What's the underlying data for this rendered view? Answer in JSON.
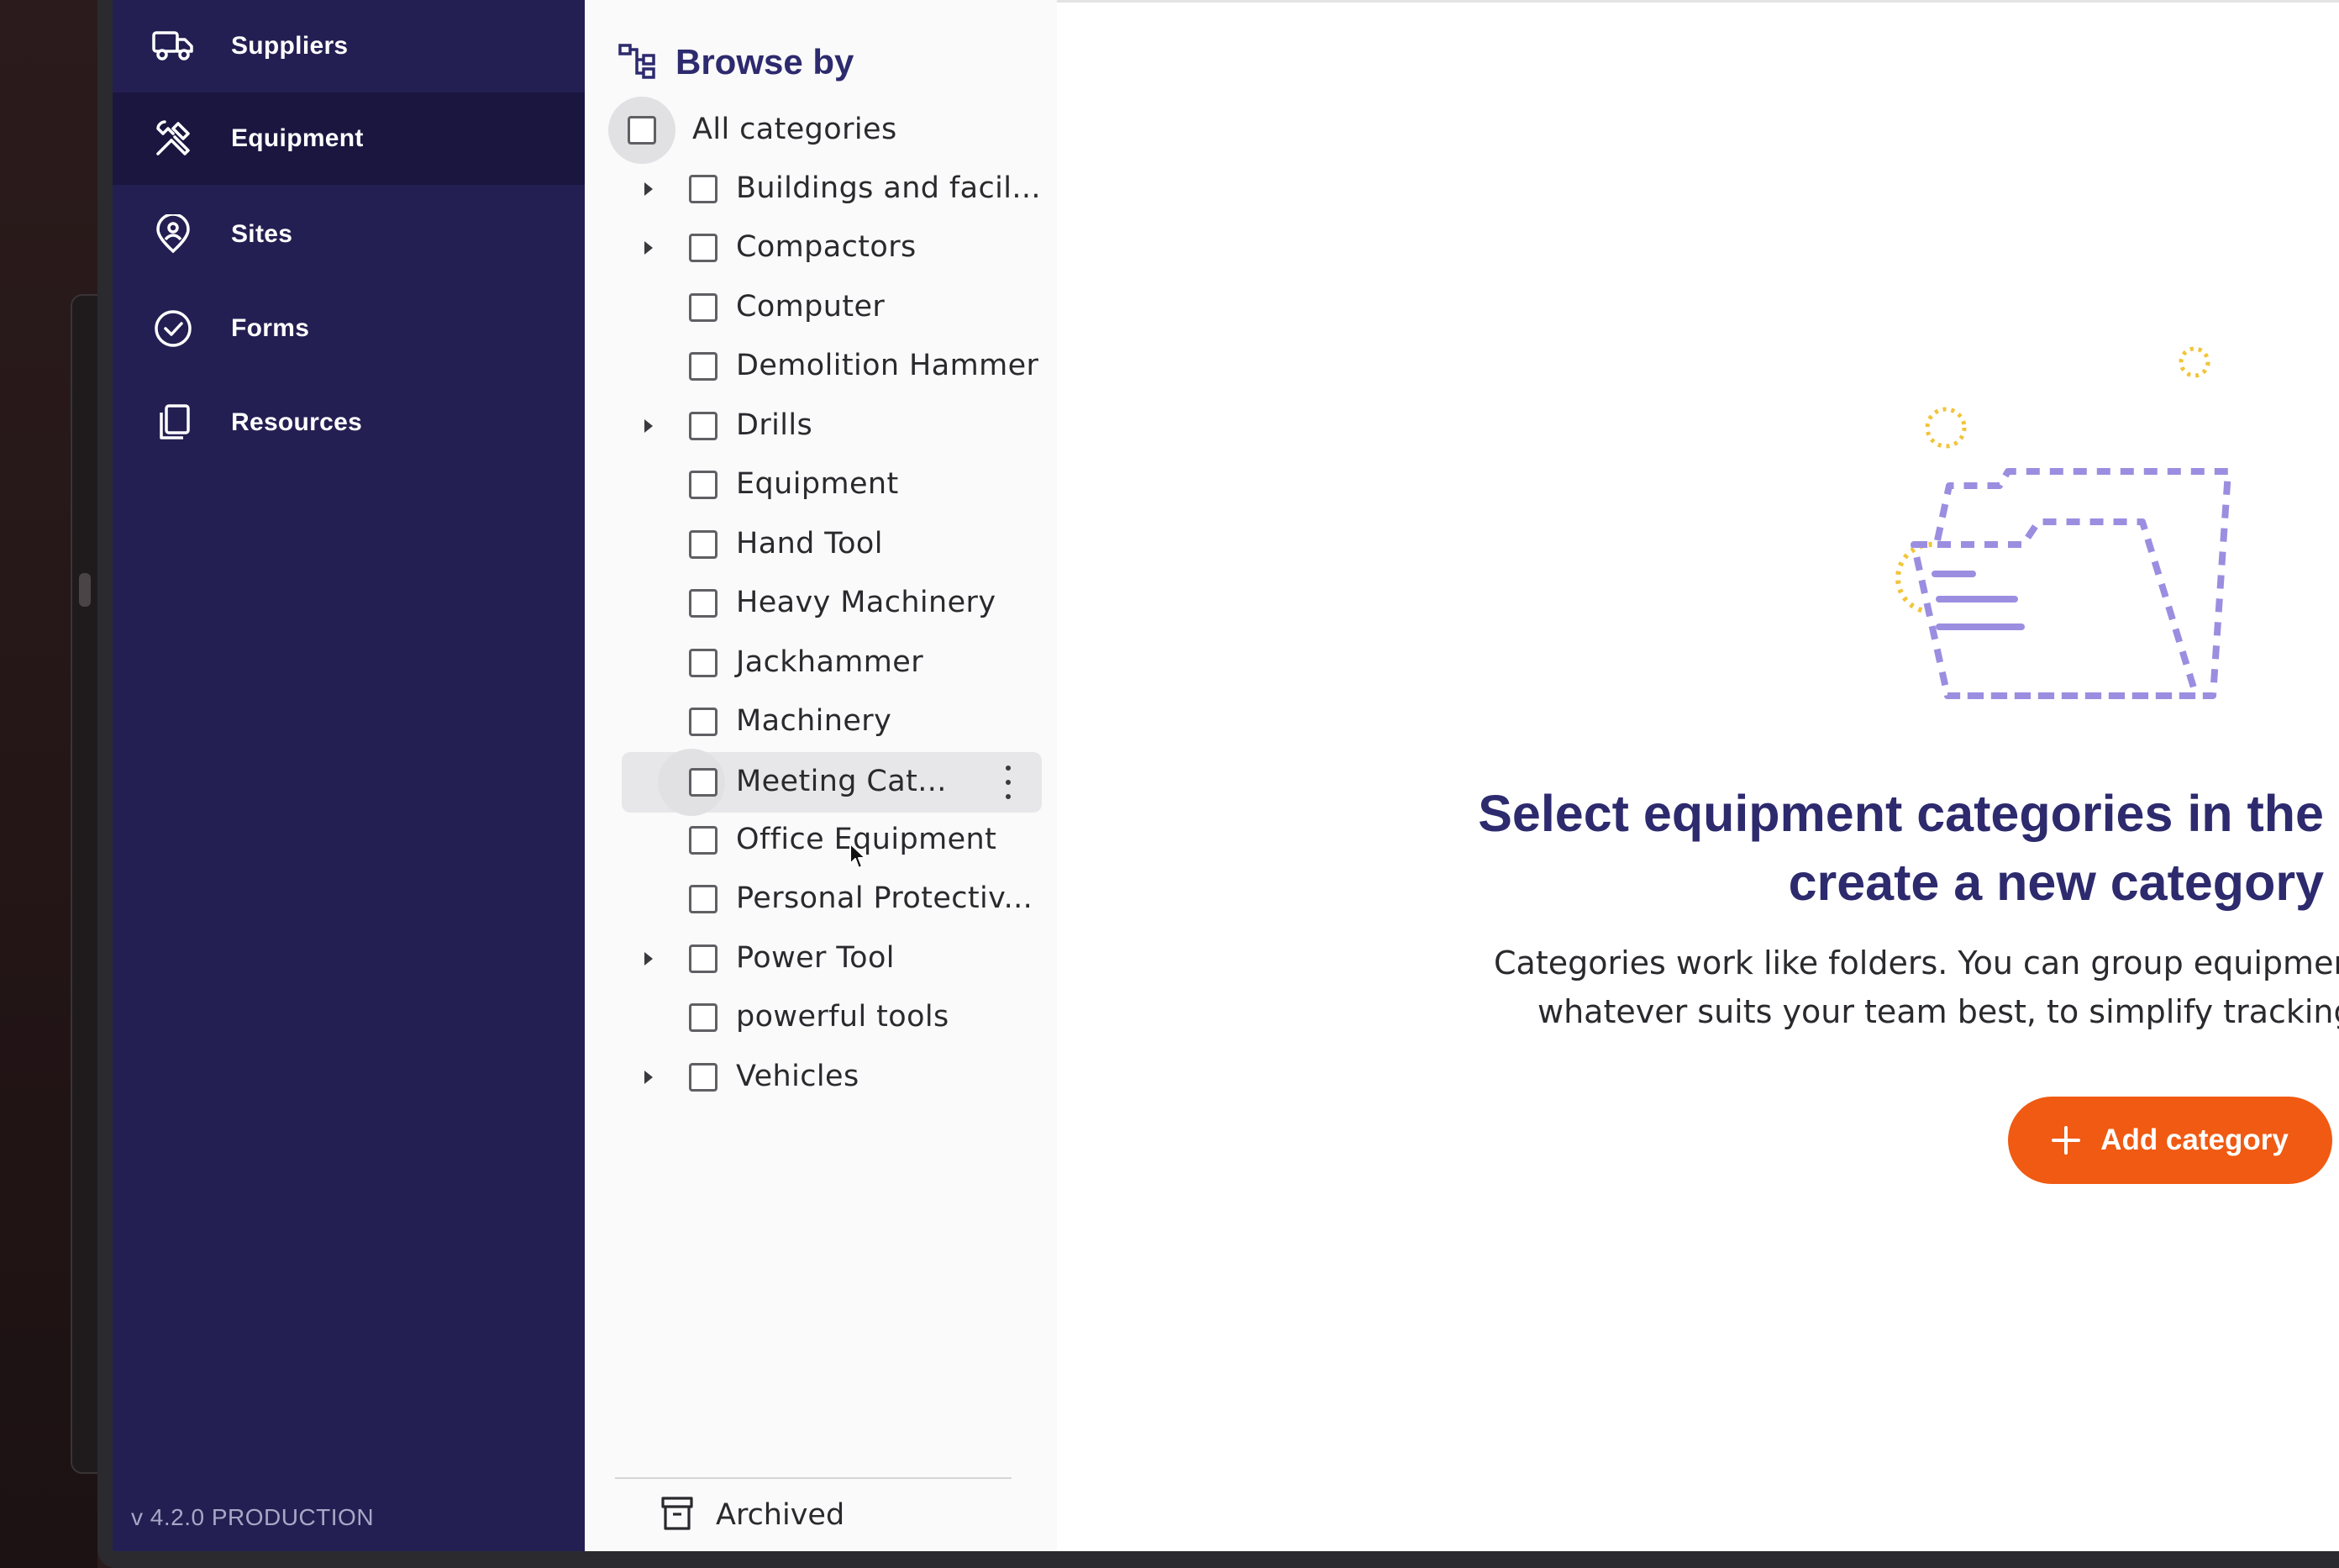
{
  "sidebar": {
    "items": [
      {
        "label": "Suppliers",
        "icon": "truck-icon"
      },
      {
        "label": "Equipment",
        "icon": "tools-icon",
        "active": true
      },
      {
        "label": "Sites",
        "icon": "location-pin-icon"
      },
      {
        "label": "Forms",
        "icon": "check-circle-icon"
      },
      {
        "label": "Resources",
        "icon": "copy-icon"
      }
    ],
    "version": "v 4.2.0 PRODUCTION"
  },
  "browse": {
    "title": "Browse by",
    "all_label": "All categories",
    "categories": [
      {
        "label": "Buildings and facil...",
        "expandable": true
      },
      {
        "label": "Compactors",
        "expandable": true
      },
      {
        "label": "Computer",
        "expandable": false
      },
      {
        "label": "Demolition Hammer",
        "expandable": false
      },
      {
        "label": "Drills",
        "expandable": true
      },
      {
        "label": "Equipment",
        "expandable": false
      },
      {
        "label": "Hand Tool",
        "expandable": false
      },
      {
        "label": "Heavy Machinery",
        "expandable": false
      },
      {
        "label": "Jackhammer",
        "expandable": false
      },
      {
        "label": "Machinery",
        "expandable": false
      },
      {
        "label": "Meeting Cat...",
        "expandable": false,
        "hovered": true
      },
      {
        "label": "Office Equipment",
        "expandable": false
      },
      {
        "label": "Personal Protectiv...",
        "expandable": false
      },
      {
        "label": "Power Tool",
        "expandable": true
      },
      {
        "label": "powerful tools",
        "expandable": false
      },
      {
        "label": "Vehicles",
        "expandable": true
      }
    ],
    "archived_label": "Archived"
  },
  "empty_state": {
    "title_line1": "Select equipment categories in the",
    "title_line2": "create a new category",
    "desc_line1": "Categories work like folders. You can group equipment b",
    "desc_line2": "whatever suits your team best, to simplify tracking an",
    "button_label": "Add category"
  },
  "colors": {
    "sidebar_bg": "#231f52",
    "sidebar_active": "#1a1640",
    "accent_title": "#2d2a6e",
    "button": "#f05a12",
    "illustration_purple": "#9b8ee0",
    "illustration_yellow": "#f2c438"
  }
}
